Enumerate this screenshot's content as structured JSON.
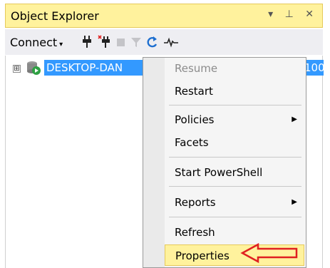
{
  "window": {
    "title": "Object Explorer",
    "title_buttons": "▾ ⊥ ✕"
  },
  "toolbar": {
    "connect_label": "Connect",
    "connect_arrow": "▾"
  },
  "tree": {
    "expander": "⊞",
    "node_label": "DESKTOP-DAN",
    "node_tail": "100"
  },
  "context_menu": {
    "items": [
      {
        "label": "Resume"
      },
      {
        "label": "Restart"
      },
      {
        "label": "Policies",
        "submenu": "▶"
      },
      {
        "label": "Facets"
      },
      {
        "label": "Start PowerShell"
      },
      {
        "label": "Reports",
        "submenu": "▶"
      },
      {
        "label": "Refresh"
      },
      {
        "label": "Properties"
      }
    ]
  },
  "colors": {
    "accent_yellow": "#fff29d",
    "selection_blue": "#3399ff",
    "arrow_red": "#e02020"
  }
}
